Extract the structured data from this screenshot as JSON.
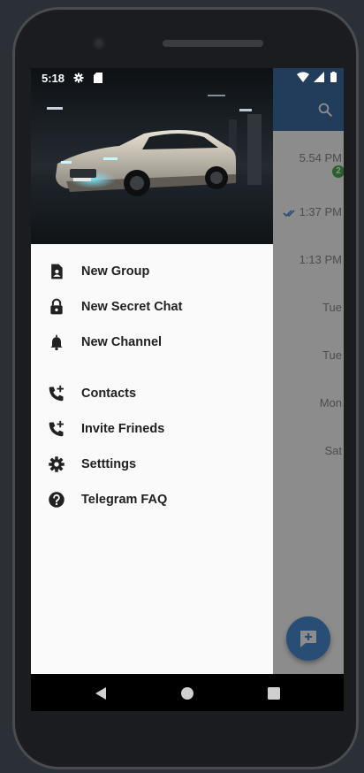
{
  "status_bar": {
    "time": "5:18",
    "left_icons": [
      "settings-icon",
      "sd-card-icon"
    ],
    "right_icons": [
      "wifi-icon",
      "signal-icon",
      "battery-icon"
    ]
  },
  "drawer": {
    "header_image": "car-in-garage-photo",
    "menu": [
      {
        "label": "New Group",
        "icon": "group-icon"
      },
      {
        "label": "New Secret Chat",
        "icon": "lock-icon"
      },
      {
        "label": "New Channel",
        "icon": "bell-icon"
      },
      {
        "label": "Contacts",
        "icon": "phone-add-icon"
      },
      {
        "label": "Invite Frineds",
        "icon": "phone-add-icon"
      },
      {
        "label": "Setttings",
        "icon": "gear-icon"
      },
      {
        "label": "Telegram FAQ",
        "icon": "help-icon"
      }
    ]
  },
  "chat_list": {
    "times": [
      "5.54 PM",
      "1:37 PM",
      "1:13 PM",
      "Tue",
      "Tue",
      "Mon",
      "Sat"
    ],
    "unread_badge": "2"
  },
  "colors": {
    "app_bar": "#3c6fa7",
    "fab": "#4b8fd6",
    "badge": "#4caf50",
    "read_ticks": "#4b8fd6"
  },
  "nav_bar": {
    "buttons": [
      "back-icon",
      "home-icon",
      "recents-icon"
    ]
  }
}
